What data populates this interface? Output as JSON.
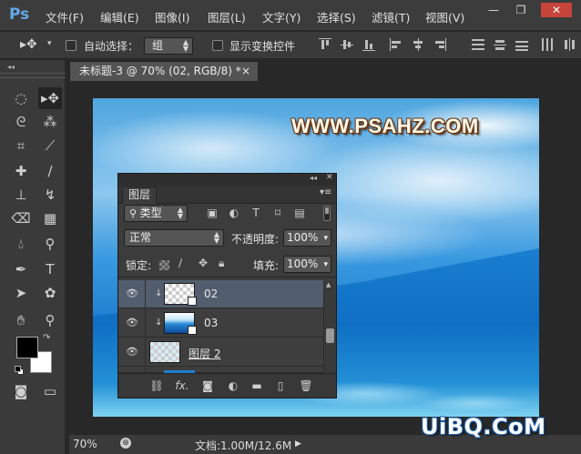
{
  "app": {
    "logo": "Ps"
  },
  "menu": [
    "文件(F)",
    "编辑(E)",
    "图像(I)",
    "图层(L)",
    "文字(Y)",
    "选择(S)",
    "滤镜(T)",
    "视图(V)"
  ],
  "window_controls": {
    "minimize": "—",
    "restore": "❐",
    "close": "✕"
  },
  "options_bar": {
    "auto_select_label": "自动选择：",
    "auto_select_value": "组",
    "show_transform_label": "显示变换控件"
  },
  "document": {
    "tab_title": "未标题-3 @ 70% (02, RGB/8) *",
    "close": "×",
    "watermark": "WWW.PSAHZ.COM"
  },
  "layers_panel": {
    "tab": "图层",
    "filter_kind": "类型",
    "blend_mode": "正常",
    "opacity_label": "不透明度:",
    "opacity_value": "100%",
    "lock_label": "锁定:",
    "fill_label": "填充:",
    "fill_value": "100%",
    "layers": [
      {
        "name": "02",
        "selected": true,
        "clipped": true
      },
      {
        "name": "03",
        "selected": false,
        "clipped": true
      },
      {
        "name": "图层 2",
        "selected": false,
        "clipped": false
      }
    ],
    "footer_icons": [
      "link-icon",
      "fx-icon",
      "mask-icon",
      "adjustment-icon",
      "group-folder-icon",
      "new-layer-icon",
      "trash-icon"
    ],
    "fx_label": "fx."
  },
  "status": {
    "zoom": "70%",
    "doc_info": "文档:1.00M/12.6M"
  },
  "brand": "UiBQ.CoM"
}
